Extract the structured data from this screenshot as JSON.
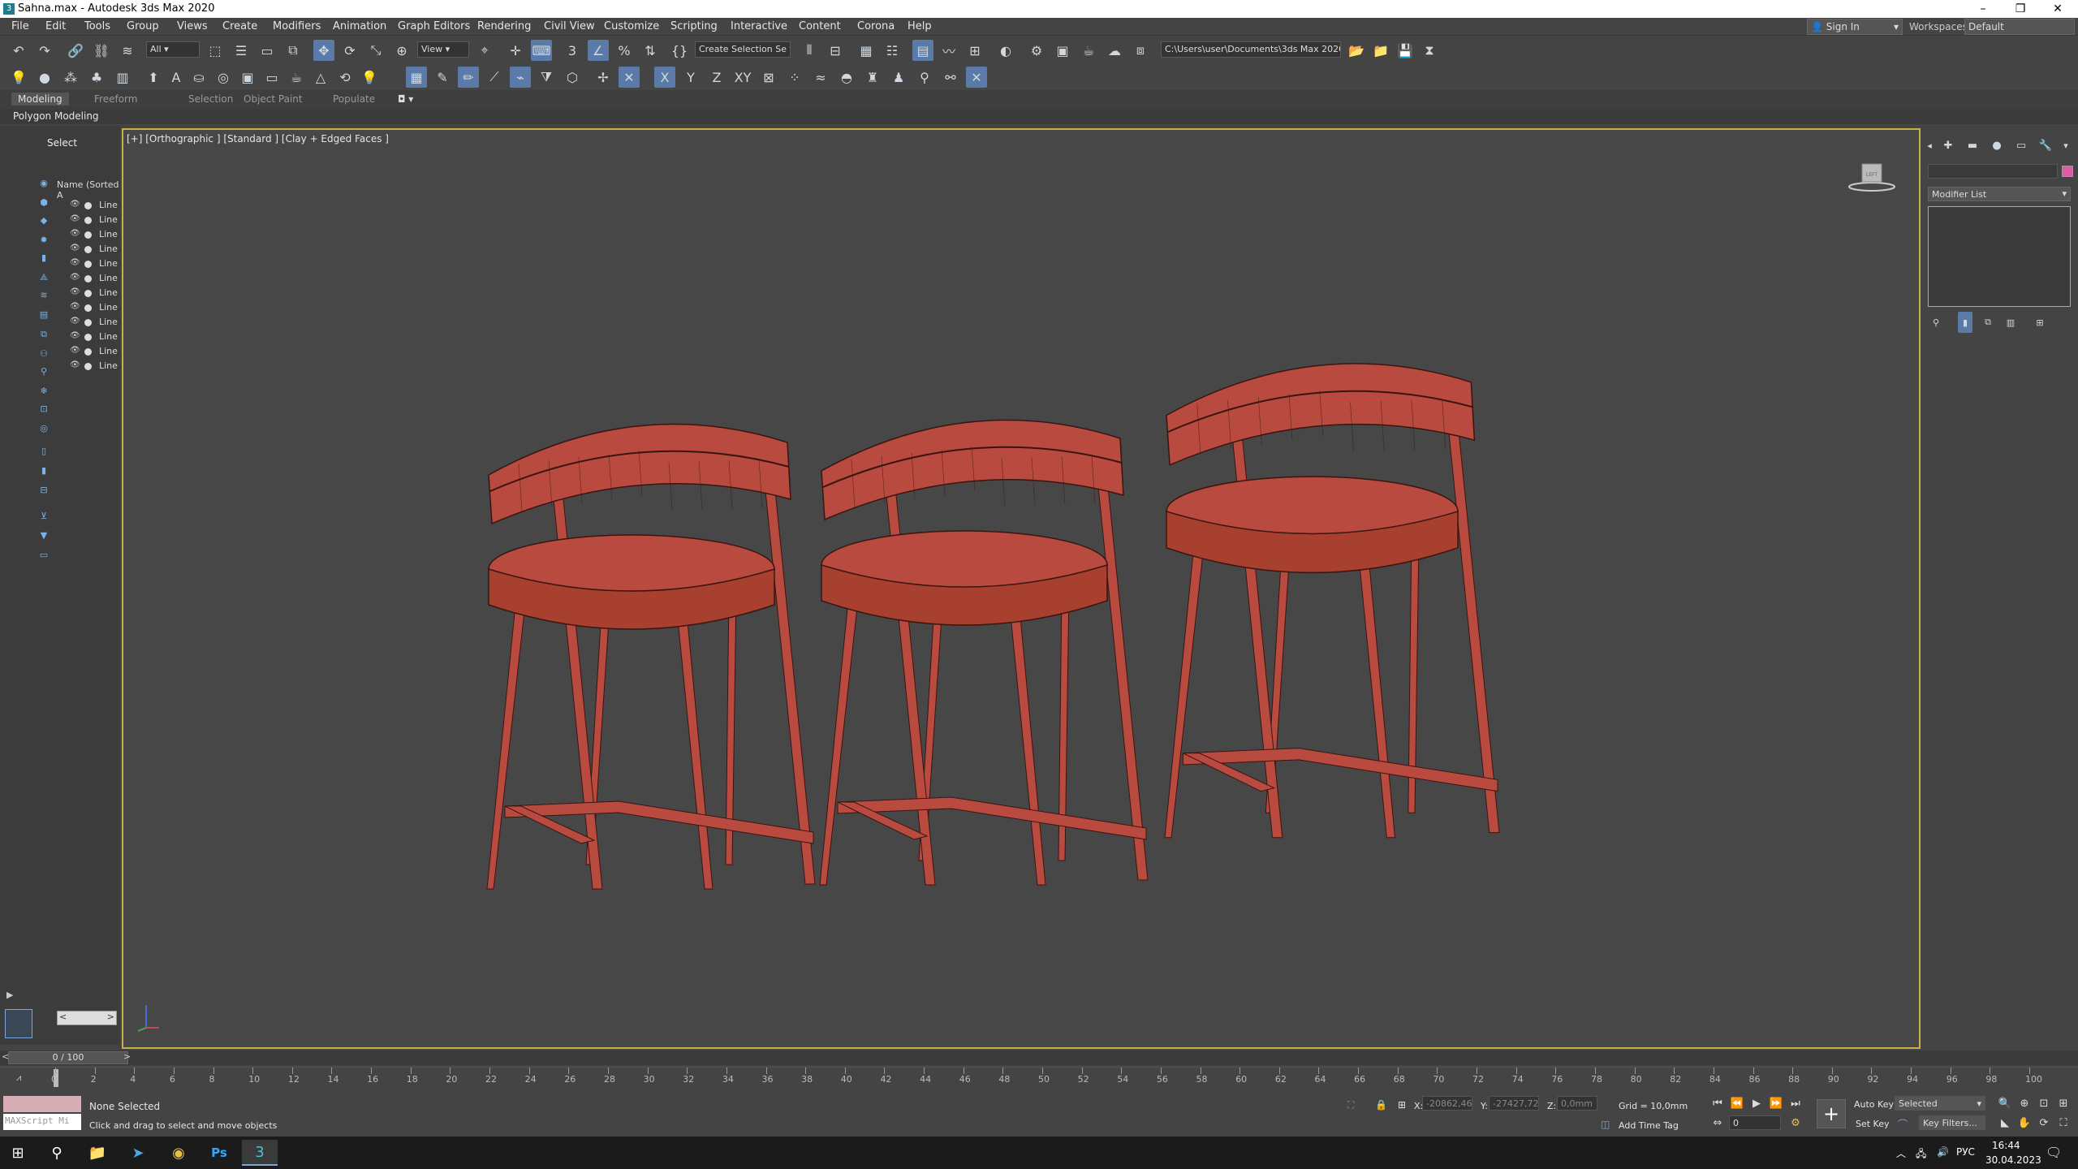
{
  "window": {
    "title": "Sahna.max - Autodesk 3ds Max 2020",
    "controls": [
      "–",
      "❐",
      "✕"
    ]
  },
  "menu": {
    "items": [
      "File",
      "Edit",
      "Tools",
      "Group",
      "Views",
      "Create",
      "Modifiers",
      "Animation",
      "Graph Editors",
      "Rendering",
      "Civil View",
      "Customize",
      "Scripting",
      "Interactive",
      "Content",
      "Corona",
      "Help"
    ],
    "sign_in": "Sign In",
    "workspaces_label": "Workspaces:",
    "workspaces_value": "Default"
  },
  "toolbar": {
    "filter": "All",
    "ref_coord": "View",
    "selection_set": "Create Selection Se",
    "project_path": "C:\\Users\\user\\Documents\\3ds Max 2020",
    "axis_x": "X",
    "axis_y": "Y",
    "axis_z": "Z",
    "axis_xy": "XY"
  },
  "ribbon": {
    "tabs": [
      "Modeling",
      "Freeform",
      "Selection",
      "Object Paint",
      "Populate"
    ],
    "active": "Modeling",
    "sub": "Polygon Modeling"
  },
  "explorer": {
    "select_label": "Select",
    "header": "Name (Sorted A",
    "rows": [
      "Line",
      "Line",
      "Line",
      "Line",
      "Line",
      "Line",
      "Line",
      "Line",
      "Line",
      "Line",
      "Line",
      "Line"
    ]
  },
  "viewport": {
    "label": "[+] [Orthographic ] [Standard ] [Clay + Edged Faces ]",
    "object_color": "#b94a3f"
  },
  "command_panel": {
    "modifier_list": "Modifier List",
    "object_color": "#e05aa8"
  },
  "timeline": {
    "frame_counter": "0 / 100",
    "ticks": [
      "0",
      "2",
      "4",
      "6",
      "8",
      "10",
      "12",
      "14",
      "16",
      "18",
      "20",
      "22",
      "24",
      "26",
      "28",
      "30",
      "32",
      "34",
      "36",
      "38",
      "40",
      "42",
      "44",
      "46",
      "48",
      "50",
      "52",
      "54",
      "56",
      "58",
      "60",
      "62",
      "64",
      "66",
      "68",
      "70",
      "72",
      "74",
      "76",
      "78",
      "80",
      "82",
      "84",
      "86",
      "88",
      "90",
      "92",
      "94",
      "96",
      "98",
      "100"
    ]
  },
  "status": {
    "maxscript_placeholder": "MAXScript Mi",
    "selection": "None Selected",
    "prompt": "Click and drag to select and move objects",
    "x_label": "X:",
    "x_value": "-20862,46",
    "y_label": "Y:",
    "y_value": "-27427,72",
    "z_label": "Z:",
    "z_value": "0,0mm",
    "grid": "Grid = 10,0mm",
    "add_time_tag": "Add Time Tag",
    "auto_key": "Auto Key",
    "set_key": "Set Key",
    "selected": "Selected",
    "key_filters": "Key Filters...",
    "current_frame": "0"
  },
  "taskbar": {
    "lang": "РУС",
    "time": "16:44",
    "date": "30.04.2023"
  }
}
